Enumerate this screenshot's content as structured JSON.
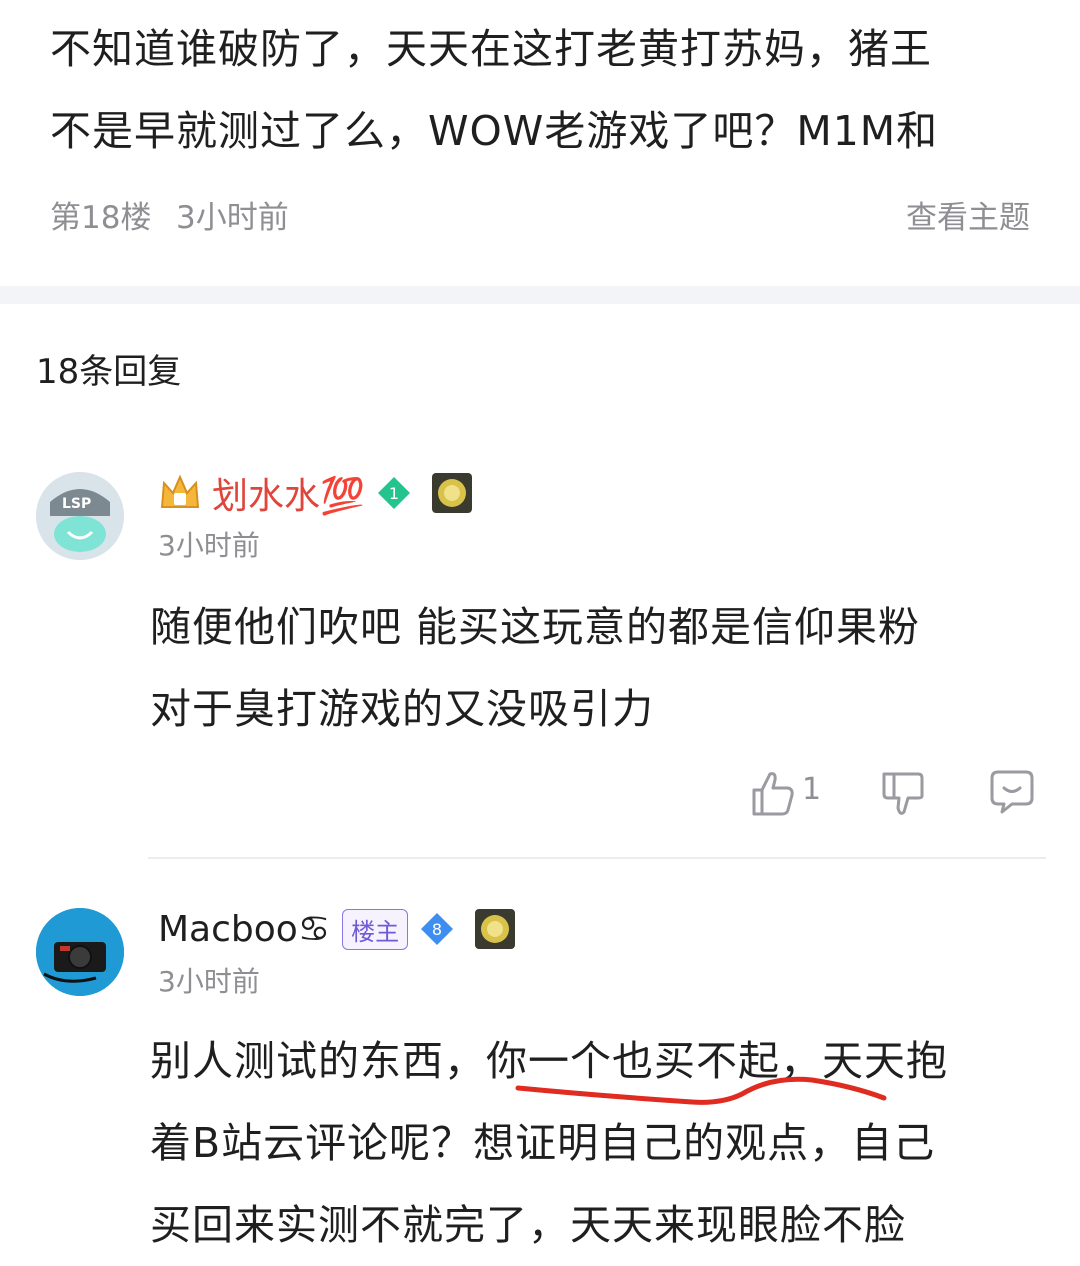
{
  "post": {
    "text_line1": "不知道谁破防了，天天在这打老黄打苏妈，猪王",
    "text_line2": "不是早就测过了么，WOW老游戏了吧？M1M和",
    "floor": "第18楼",
    "time": "3小时前",
    "view_topic": "查看主题"
  },
  "replies_header": "18条回复",
  "comments": [
    {
      "username": "划水水💯",
      "level": "1",
      "time": "3小时前",
      "text_line1": "随便他们吹吧 能买这玩意的都是信仰果粉",
      "text_line2": "对于臭打游戏的又没吸引力",
      "like_count": "1"
    },
    {
      "username": "Macboo♋",
      "host_tag": "楼主",
      "level": "8",
      "time": "3小时前",
      "text_line1": "别人测试的东西，你一个也买不起，天天抱",
      "text_line2": "着B站云评论呢？想证明自己的观点，自己",
      "text_line3": "买回来实测不就完了，天天来现眼脸不脸"
    }
  ],
  "colors": {
    "vip_red": "#e0453c",
    "underline_red": "#e02b21",
    "diamond_green": "#25c48f",
    "diamond_blue": "#3d8ef0",
    "host_purple": "#6f5bd6"
  }
}
